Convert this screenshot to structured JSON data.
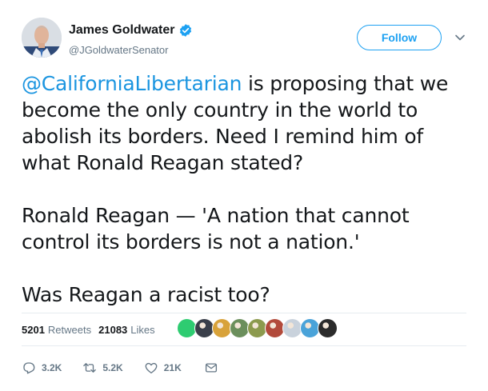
{
  "user": {
    "display_name": "James Goldwater",
    "handle": "@JGoldwaterSenator",
    "verified": true,
    "avatar_icon": "profile-photo"
  },
  "follow_button": {
    "label": "Follow"
  },
  "menu": {
    "icon": "chevron-down-icon"
  },
  "tweet": {
    "mention": "@CaliforniaLibertarian",
    "body": " is proposing that we\nbecome the only country in the world to\nabolish its borders. Need I remind him of\nwhat Ronald Reagan stated?\n\nRonald Reagan — 'A nation that cannot\ncontrol its borders is not a nation.'\n\nWas Reagan a racist too?"
  },
  "stats": {
    "retweets_count": "5201",
    "retweets_label": "Retweets",
    "likes_count": "21083",
    "likes_label": "Likes"
  },
  "likers": {
    "count": 9,
    "colors": [
      "#2ecc71",
      "#3a3f4a",
      "#d8a23a",
      "#6b8f5c",
      "#8c9a4e",
      "#b24a3b",
      "#c9d2dc",
      "#4aa3d9",
      "#2b2b2b"
    ]
  },
  "actions": {
    "reply_count": "3.2K",
    "retweet_count": "5.2K",
    "like_count": "21K",
    "colors": {
      "icon": "#657786",
      "accent": "#1da1f2"
    }
  }
}
